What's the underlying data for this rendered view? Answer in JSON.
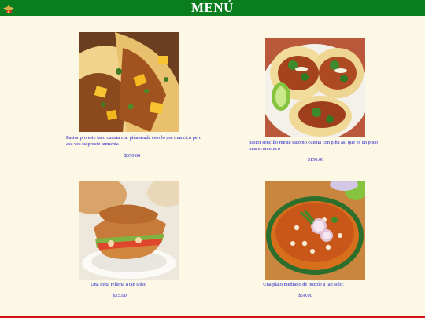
{
  "header": {
    "title": "MENÚ",
    "logo_icon": "sombrero-logo-icon"
  },
  "items": [
    {
      "description": "Pastor pro este taco cuenta con piña asada esto lo ase mas rico pero asu ves su precio aumenta",
      "price": "$350.00",
      "image_icon": "tacos-al-pastor-pineapple-photo"
    },
    {
      "description": "pastor sencillo meste taco no cuenta con piña asi que es un poco mas economico",
      "price": "$150.00",
      "image_icon": "tacos-pastor-cilantro-lime-photo"
    },
    {
      "description": "Una torta rellena a tan solo:",
      "price": "$25.00",
      "image_icon": "torta-sandwich-photo"
    },
    {
      "description": "Una plato mediano de pozole a tan solo:",
      "price": "$50.00",
      "image_icon": "pozole-bowl-photo"
    }
  ],
  "colors": {
    "header_bg": "#0a7d1e",
    "page_bg": "#fdf7e6",
    "text": "#1c1cc4",
    "footer_line": "#d11212"
  }
}
